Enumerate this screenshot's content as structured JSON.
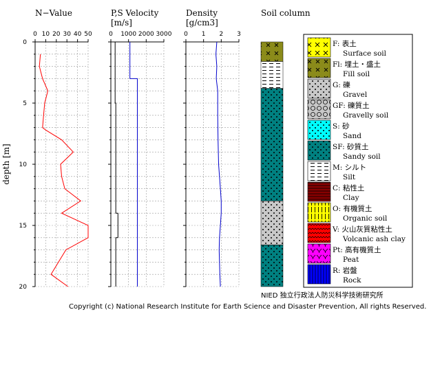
{
  "chart_data": [
    {
      "type": "line",
      "title": "N−Value",
      "ylabel": "depth [m]",
      "xlim": [
        0,
        50
      ],
      "ylim": [
        0,
        20
      ],
      "xticks": [
        0,
        10,
        20,
        30,
        40,
        50
      ],
      "yticks": [
        0,
        5,
        10,
        15,
        20
      ],
      "series": [
        {
          "color": "#ff0000",
          "points": [
            [
              5,
              1
            ],
            [
              4,
              2
            ],
            [
              7,
              3
            ],
            [
              12,
              4
            ],
            [
              9,
              5
            ],
            [
              8,
              6
            ],
            [
              7,
              7
            ],
            [
              10,
              7.2
            ],
            [
              25,
              8
            ],
            [
              36,
              9
            ],
            [
              24,
              10
            ],
            [
              25,
              11
            ],
            [
              28,
              12
            ],
            [
              43,
              13
            ],
            [
              25,
              14
            ],
            [
              50,
              15
            ],
            [
              50,
              16
            ],
            [
              29,
              17
            ],
            [
              15,
              19
            ],
            [
              31,
              20
            ]
          ]
        }
      ]
    },
    {
      "type": "line",
      "title": "P,S Velocity",
      "subtitle": "[m/s]",
      "xlim": [
        0,
        3000
      ],
      "ylim": [
        0,
        20
      ],
      "xticks": [
        0,
        1000,
        2000,
        3000
      ],
      "series": [
        {
          "color": "#0000cc",
          "points": [
            [
              1080,
              0
            ],
            [
              1080,
              3
            ],
            [
              1500,
              3
            ],
            [
              1500,
              20
            ]
          ]
        },
        {
          "color": "#000000",
          "points": [
            [
              240,
              0
            ],
            [
              240,
              5
            ],
            [
              280,
              5
            ],
            [
              280,
              14
            ],
            [
              400,
              14
            ],
            [
              400,
              16
            ],
            [
              280,
              16
            ],
            [
              280,
              20
            ]
          ]
        }
      ]
    },
    {
      "type": "line",
      "title": "Density",
      "subtitle": "[g/cm3]",
      "xlim": [
        0,
        3
      ],
      "ylim": [
        0,
        20
      ],
      "xticks": [
        0,
        1,
        2,
        3
      ],
      "series": [
        {
          "color": "#0000cc",
          "points": [
            [
              1.75,
              0
            ],
            [
              1.7,
              1
            ],
            [
              1.75,
              2
            ],
            [
              1.72,
              3
            ],
            [
              1.8,
              4
            ],
            [
              1.8,
              6
            ],
            [
              1.82,
              8
            ],
            [
              1.85,
              10
            ],
            [
              1.9,
              11
            ],
            [
              1.95,
              12
            ],
            [
              2.0,
              13
            ],
            [
              2.0,
              14
            ],
            [
              1.95,
              15
            ],
            [
              1.9,
              16
            ],
            [
              1.88,
              17
            ],
            [
              1.9,
              18
            ],
            [
              1.92,
              19
            ],
            [
              1.95,
              20
            ]
          ]
        }
      ]
    }
  ],
  "soil_column": {
    "title": "Soil column",
    "layers": [
      {
        "code": "Fl",
        "from": 0,
        "to": 1.6
      },
      {
        "code": "M",
        "from": 1.6,
        "to": 3.8
      },
      {
        "code": "SF",
        "from": 3.8,
        "to": 13
      },
      {
        "code": "G",
        "from": 13,
        "to": 16.6
      },
      {
        "code": "SF",
        "from": 16.6,
        "to": 20
      }
    ],
    "footer": "NIED 独立行政法人防災科学技術研究所"
  },
  "legend": [
    {
      "code": "F",
      "ja": "F: 表土",
      "en": "Surface soil",
      "pattern": "F"
    },
    {
      "code": "Fl",
      "ja": "Fl: 埋土・盛土",
      "en": "Fill soil",
      "pattern": "Fl"
    },
    {
      "code": "G",
      "ja": "G: 礫",
      "en": "Gravel",
      "pattern": "G"
    },
    {
      "code": "GF",
      "ja": "GF: 礫質土",
      "en": "Gravelly soil",
      "pattern": "GF"
    },
    {
      "code": "S",
      "ja": "S: 砂",
      "en": "Sand",
      "pattern": "S"
    },
    {
      "code": "SF",
      "ja": "SF: 砂質土",
      "en": "Sandy soil",
      "pattern": "SF"
    },
    {
      "code": "M",
      "ja": "M: シルト",
      "en": "Silt",
      "pattern": "M"
    },
    {
      "code": "C",
      "ja": "C: 粘性土",
      "en": "Clay",
      "pattern": "C"
    },
    {
      "code": "O",
      "ja": "O: 有機質土",
      "en": "Organic soil",
      "pattern": "O"
    },
    {
      "code": "V",
      "ja": "V: 火山灰質粘性土",
      "en": "Volcanic ash clay",
      "pattern": "V"
    },
    {
      "code": "Pt",
      "ja": "Pt: 高有機質土",
      "en": "Peat",
      "pattern": "Pt"
    },
    {
      "code": "R",
      "ja": "R: 岩盤",
      "en": "Rock",
      "pattern": "R"
    }
  ],
  "copyright": "Copyright (c) National Research Institute for Earth Science and Disaster Prevention, All rights Reserved."
}
